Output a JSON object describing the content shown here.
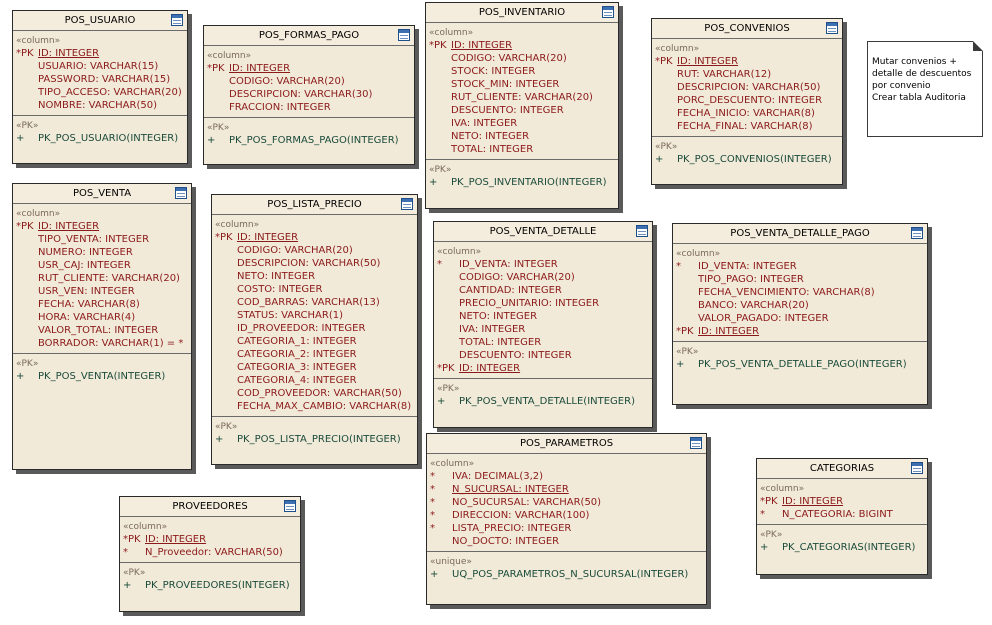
{
  "tables": [
    {
      "name": "POS_USUARIO",
      "sections": [
        {
          "stereo": "«column»",
          "rows": [
            {
              "flag": "*PK",
              "text": "ID:  INTEGER",
              "pk": true
            },
            {
              "flag": "",
              "text": "USUARIO:  VARCHAR(15)"
            },
            {
              "flag": "",
              "text": "PASSWORD:  VARCHAR(15)"
            },
            {
              "flag": "",
              "text": "TIPO_ACCESO:  VARCHAR(20)"
            },
            {
              "flag": "",
              "text": "NOMBRE:  VARCHAR(50)"
            }
          ]
        },
        {
          "stereo": "«PK»",
          "rows": [
            {
              "flag": "+",
              "text": "PK_POS_USUARIO(INTEGER)",
              "idx": true
            }
          ]
        }
      ]
    },
    {
      "name": "POS_FORMAS_PAGO",
      "sections": [
        {
          "stereo": "«column»",
          "rows": [
            {
              "flag": "*PK",
              "text": "ID:  INTEGER",
              "pk": true
            },
            {
              "flag": "",
              "text": "CODIGO:  VARCHAR(20)"
            },
            {
              "flag": "",
              "text": "DESCRIPCION:  VARCHAR(30)"
            },
            {
              "flag": "",
              "text": "FRACCION:  INTEGER"
            }
          ]
        },
        {
          "stereo": "«PK»",
          "rows": [
            {
              "flag": "+",
              "text": "PK_POS_FORMAS_PAGO(INTEGER)",
              "idx": true
            }
          ]
        }
      ]
    },
    {
      "name": "POS_INVENTARIO",
      "sections": [
        {
          "stereo": "«column»",
          "rows": [
            {
              "flag": "*PK",
              "text": "ID:  INTEGER",
              "pk": true
            },
            {
              "flag": "",
              "text": "CODIGO:  VARCHAR(20)"
            },
            {
              "flag": "",
              "text": "STOCK:  INTEGER"
            },
            {
              "flag": "",
              "text": "STOCK_MIN:  INTEGER"
            },
            {
              "flag": "",
              "text": "RUT_CLIENTE:  VARCHAR(20)"
            },
            {
              "flag": "",
              "text": "DESCUENTO:  INTEGER"
            },
            {
              "flag": "",
              "text": "IVA:  INTEGER"
            },
            {
              "flag": "",
              "text": "NETO:  INTEGER"
            },
            {
              "flag": "",
              "text": "TOTAL:  INTEGER"
            }
          ]
        },
        {
          "stereo": "«PK»",
          "rows": [
            {
              "flag": "+",
              "text": "PK_POS_INVENTARIO(INTEGER)",
              "idx": true
            }
          ]
        }
      ]
    },
    {
      "name": "POS_CONVENIOS",
      "sections": [
        {
          "stereo": "«column»",
          "rows": [
            {
              "flag": "*PK",
              "text": "ID:  INTEGER",
              "pk": true
            },
            {
              "flag": "",
              "text": "RUT:  VARCHAR(12)"
            },
            {
              "flag": "",
              "text": "DESCRIPCION:  VARCHAR(50)"
            },
            {
              "flag": "",
              "text": "PORC_DESCUENTO:  INTEGER"
            },
            {
              "flag": "",
              "text": "FECHA_INICIO:  VARCHAR(8)"
            },
            {
              "flag": "",
              "text": "FECHA_FINAL:  VARCHAR(8)"
            }
          ]
        },
        {
          "stereo": "«PK»",
          "rows": [
            {
              "flag": "+",
              "text": "PK_POS_CONVENIOS(INTEGER)",
              "idx": true
            }
          ]
        }
      ]
    },
    {
      "name": "POS_VENTA",
      "sections": [
        {
          "stereo": "«column»",
          "rows": [
            {
              "flag": "*PK",
              "text": "ID:  INTEGER",
              "pk": true
            },
            {
              "flag": "",
              "text": "TIPO_VENTA:  INTEGER"
            },
            {
              "flag": "",
              "text": "NUMERO:  INTEGER"
            },
            {
              "flag": "",
              "text": "USR_CAJ:  INTEGER"
            },
            {
              "flag": "",
              "text": "RUT_CLIENTE:  VARCHAR(20)"
            },
            {
              "flag": "",
              "text": "USR_VEN:  INTEGER"
            },
            {
              "flag": "",
              "text": "FECHA:  VARCHAR(8)"
            },
            {
              "flag": "",
              "text": "HORA:  VARCHAR(4)"
            },
            {
              "flag": "",
              "text": "VALOR_TOTAL:  INTEGER"
            },
            {
              "flag": "",
              "text": "BORRADOR:  VARCHAR(1) = *"
            }
          ]
        },
        {
          "stereo": "«PK»",
          "rows": [
            {
              "flag": "+",
              "text": "PK_POS_VENTA(INTEGER)",
              "idx": true
            }
          ]
        }
      ]
    },
    {
      "name": "POS_LISTA_PRECIO",
      "sections": [
        {
          "stereo": "«column»",
          "rows": [
            {
              "flag": "*PK",
              "text": "ID:  INTEGER",
              "pk": true
            },
            {
              "flag": "",
              "text": "CODIGO:  VARCHAR(20)"
            },
            {
              "flag": "",
              "text": "DESCRIPCION:  VARCHAR(50)"
            },
            {
              "flag": "",
              "text": "NETO:  INTEGER"
            },
            {
              "flag": "",
              "text": "COSTO:  INTEGER"
            },
            {
              "flag": "",
              "text": "COD_BARRAS:  VARCHAR(13)"
            },
            {
              "flag": "",
              "text": "STATUS:  VARCHAR(1)"
            },
            {
              "flag": "",
              "text": "ID_PROVEEDOR:  INTEGER"
            },
            {
              "flag": "",
              "text": "CATEGORIA_1:  INTEGER"
            },
            {
              "flag": "",
              "text": "CATEGORIA_2:  INTEGER"
            },
            {
              "flag": "",
              "text": "CATEGORIA_3:  INTEGER"
            },
            {
              "flag": "",
              "text": "CATEGORIA_4:  INTEGER"
            },
            {
              "flag": "",
              "text": "COD_PROVEEDOR:  VARCHAR(50)"
            },
            {
              "flag": "",
              "text": "FECHA_MAX_CAMBIO:  VARCHAR(8)"
            }
          ]
        },
        {
          "stereo": "«PK»",
          "rows": [
            {
              "flag": "+",
              "text": "PK_POS_LISTA_PRECIO(INTEGER)",
              "idx": true
            }
          ]
        }
      ]
    },
    {
      "name": "POS_VENTA_DETALLE",
      "sections": [
        {
          "stereo": "«column»",
          "rows": [
            {
              "flag": "*",
              "text": "ID_VENTA:  INTEGER"
            },
            {
              "flag": "",
              "text": "CODIGO:  VARCHAR(20)"
            },
            {
              "flag": "",
              "text": "CANTIDAD:  INTEGER"
            },
            {
              "flag": "",
              "text": "PRECIO_UNITARIO:  INTEGER"
            },
            {
              "flag": "",
              "text": "NETO:  INTEGER"
            },
            {
              "flag": "",
              "text": "IVA:  INTEGER"
            },
            {
              "flag": "",
              "text": "TOTAL:  INTEGER"
            },
            {
              "flag": "",
              "text": "DESCUENTO:  INTEGER"
            },
            {
              "flag": "*PK",
              "text": "ID:  INTEGER",
              "pk": true
            }
          ]
        },
        {
          "stereo": "«PK»",
          "rows": [
            {
              "flag": "+",
              "text": "PK_POS_VENTA_DETALLE(INTEGER)",
              "idx": true
            }
          ]
        }
      ]
    },
    {
      "name": "POS_VENTA_DETALLE_PAGO",
      "sections": [
        {
          "stereo": "«column»",
          "rows": [
            {
              "flag": "*",
              "text": "ID_VENTA:  INTEGER"
            },
            {
              "flag": "",
              "text": "TIPO_PAGO:  INTEGER"
            },
            {
              "flag": "",
              "text": "FECHA_VENCIMIENTO:  VARCHAR(8)"
            },
            {
              "flag": "",
              "text": "BANCO:  VARCHAR(20)"
            },
            {
              "flag": "",
              "text": "VALOR_PAGADO:  INTEGER"
            },
            {
              "flag": "*PK",
              "text": "ID:  INTEGER",
              "pk": true
            }
          ]
        },
        {
          "stereo": "«PK»",
          "rows": [
            {
              "flag": "+",
              "text": "PK_POS_VENTA_DETALLE_PAGO(INTEGER)",
              "idx": true
            }
          ]
        }
      ]
    },
    {
      "name": "POS_PARAMETROS",
      "sections": [
        {
          "stereo": "«column»",
          "rows": [
            {
              "flag": "*",
              "text": "IVA:  DECIMAL(3,2)"
            },
            {
              "flag": "*",
              "text": "N_SUCURSAL:  INTEGER",
              "pk": true
            },
            {
              "flag": "*",
              "text": "NO_SUCURSAL:  VARCHAR(50)"
            },
            {
              "flag": "*",
              "text": "DIRECCION:  VARCHAR(100)"
            },
            {
              "flag": "*",
              "text": "LISTA_PRECIO:  INTEGER"
            },
            {
              "flag": "",
              "text": "NO_DOCTO:  INTEGER"
            }
          ]
        },
        {
          "stereo": "«unique»",
          "rows": [
            {
              "flag": "+",
              "text": "UQ_POS_PARAMETROS_N_SUCURSAL(INTEGER)",
              "idx": true
            }
          ]
        }
      ]
    },
    {
      "name": "CATEGORIAS",
      "sections": [
        {
          "stereo": "«column»",
          "rows": [
            {
              "flag": "*PK",
              "text": "ID:  INTEGER",
              "pk": true
            },
            {
              "flag": "*",
              "text": "N_CATEGORIA:  BIGINT"
            }
          ]
        },
        {
          "stereo": "«PK»",
          "rows": [
            {
              "flag": "+",
              "text": "PK_CATEGORIAS(INTEGER)",
              "idx": true
            }
          ]
        }
      ]
    },
    {
      "name": "PROVEEDORES",
      "sections": [
        {
          "stereo": "«column»",
          "rows": [
            {
              "flag": "*PK",
              "text": "ID:  INTEGER",
              "pk": true
            },
            {
              "flag": "*",
              "text": "N_Proveedor:  VARCHAR(50)"
            }
          ]
        },
        {
          "stereo": "«PK»",
          "rows": [
            {
              "flag": "+",
              "text": "PK_PROVEEDORES(INTEGER)",
              "idx": true
            }
          ]
        }
      ]
    }
  ],
  "note": {
    "lines": [
      "Mutar convenios +",
      "detalle de descuentos",
      "por convenio",
      "Crear tabla Auditoria"
    ]
  }
}
